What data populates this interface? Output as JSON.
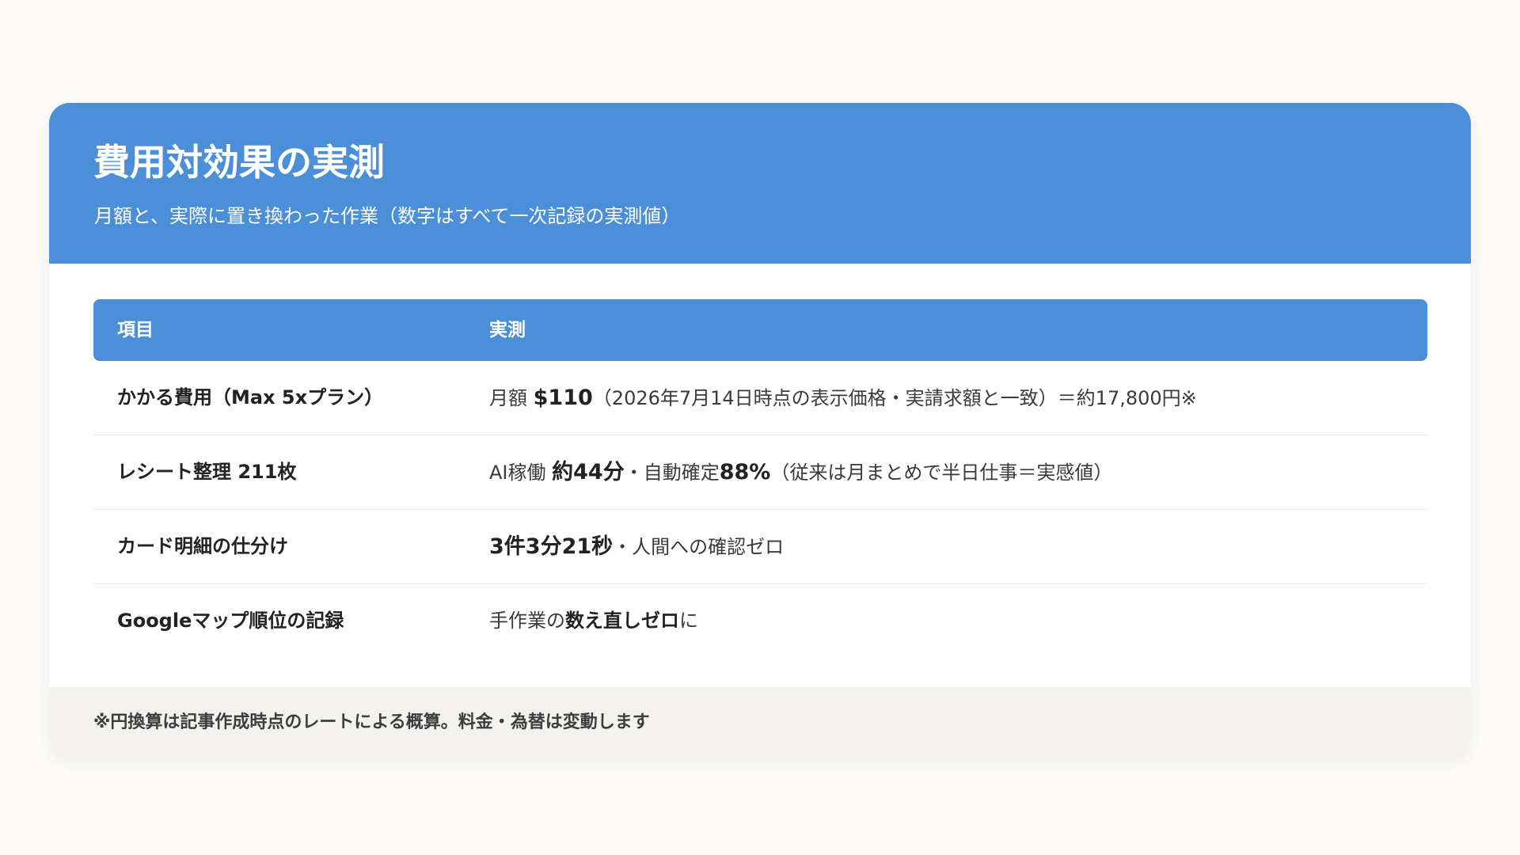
{
  "header": {
    "title": "費用対効果の実測",
    "subtitle": "月額と、実際に置き換わった作業（数字はすべて一次記録の実測値）"
  },
  "table": {
    "columns": [
      "項目",
      "実測"
    ],
    "rows": [
      {
        "item": "かかる費用（Max 5xプラン）",
        "value_parts": [
          "月額 ",
          "$110",
          "（2026年7月14日時点の表示価格・実請求額と一致）＝約17,800円※"
        ]
      },
      {
        "item": "レシート整理 211枚",
        "value_parts": [
          "AI稼働 ",
          "約44分",
          "・自動確定",
          "88%",
          "（従来は月まとめで半日仕事＝実感値）"
        ]
      },
      {
        "item": "カード明細の仕分け",
        "value_parts": [
          "3件3分21秒",
          "・人間への確認ゼロ"
        ]
      },
      {
        "item": "Googleマップ順位の記録",
        "value_parts": [
          "手作業の",
          "数え直しゼロ",
          "に"
        ]
      }
    ]
  },
  "footer": {
    "note": "※円換算は記事作成時点のレートによる概算。料金・為替は変動します"
  },
  "colors": {
    "accent": "#4b8fd9",
    "background": "#fcfbf9",
    "footer_bg": "#f3f2ef"
  }
}
